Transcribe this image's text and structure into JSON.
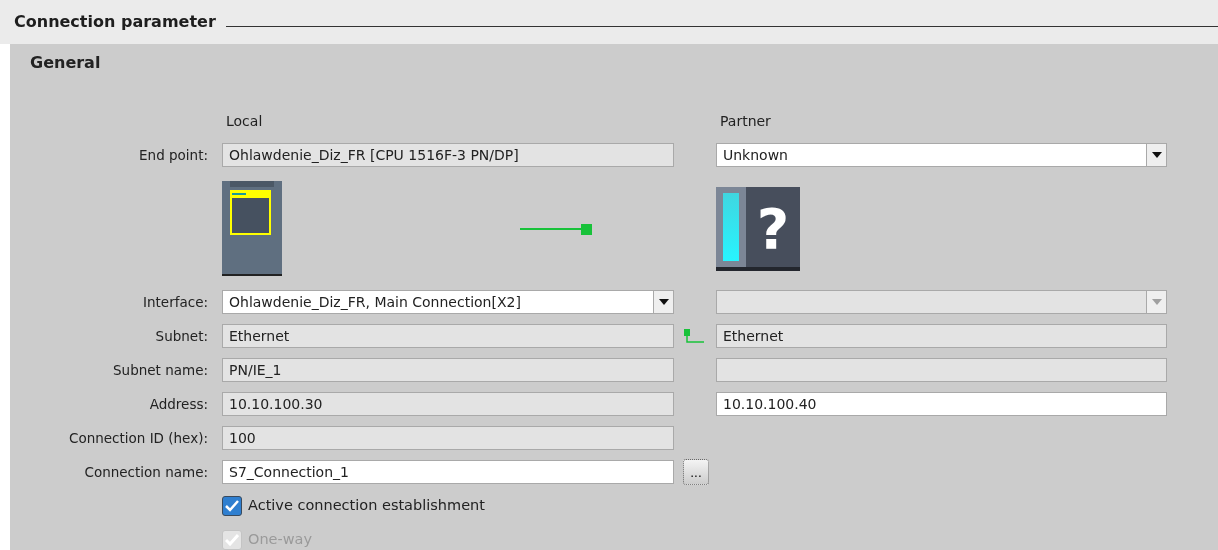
{
  "title": "Connection parameter",
  "section": "General",
  "column_headers": {
    "local": "Local",
    "partner": "Partner"
  },
  "endpoint": {
    "label": "End point:",
    "local": {
      "kind": "readonly",
      "value": "Ohlawdenie_Diz_FR [CPU 1516F-3 PN/DP]"
    },
    "partner": {
      "kind": "select",
      "disabled": false,
      "value": "Unknown"
    }
  },
  "partner_device": {
    "glyph": "?"
  },
  "rows": [
    {
      "label": "Interface:",
      "local": {
        "kind": "select",
        "disabled": false,
        "value": "Ohlawdenie_Diz_FR, Main Connection[X2]"
      },
      "partner": {
        "kind": "select",
        "disabled": true
      }
    },
    {
      "label": "Subnet:",
      "link": true,
      "local": {
        "kind": "readonly",
        "value": "Ethernet"
      },
      "partner": {
        "kind": "readonly",
        "value": "Ethernet"
      }
    },
    {
      "label": "Subnet name:",
      "local": {
        "kind": "readonly",
        "value": "PN/IE_1"
      },
      "partner": {
        "kind": "readonly"
      }
    },
    {
      "label": "Address:",
      "local": {
        "kind": "readonly",
        "value": "10.10.100.30"
      },
      "partner": {
        "kind": "input",
        "value": "10.10.100.40"
      }
    },
    {
      "label": "Connection ID (hex):",
      "local": {
        "kind": "readonly",
        "value": "100"
      }
    },
    {
      "label": "Connection name:",
      "local": {
        "kind": "input",
        "value": "S7_Connection_1"
      },
      "browse": "..."
    }
  ],
  "checkboxes": [
    {
      "label": "Active connection establishment",
      "checked": true,
      "disabled": false
    },
    {
      "label": "One-way",
      "checked": true,
      "disabled": true
    }
  ]
}
